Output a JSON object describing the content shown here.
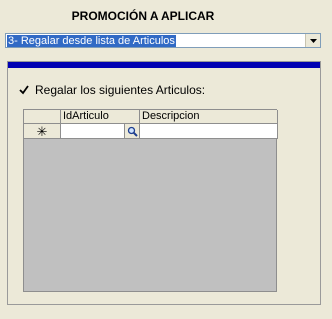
{
  "dialog": {
    "title": "PROMOCIÓN A APLICAR"
  },
  "promo_select": {
    "value": "3- Regalar desde lista de Articulos",
    "arrow_icon": "chevron-down-icon"
  },
  "panel": {
    "accent_color": "#0000b3",
    "checkbox": {
      "checked": true,
      "label": "Regalar los siguientes Articulos:"
    },
    "grid": {
      "columns": [
        "IdArticulo",
        "Descripcion"
      ],
      "new_row": {
        "indicator": "✳",
        "id_articulo": "",
        "descripcion": "",
        "lookup_icon": "magnifier-icon"
      }
    }
  }
}
